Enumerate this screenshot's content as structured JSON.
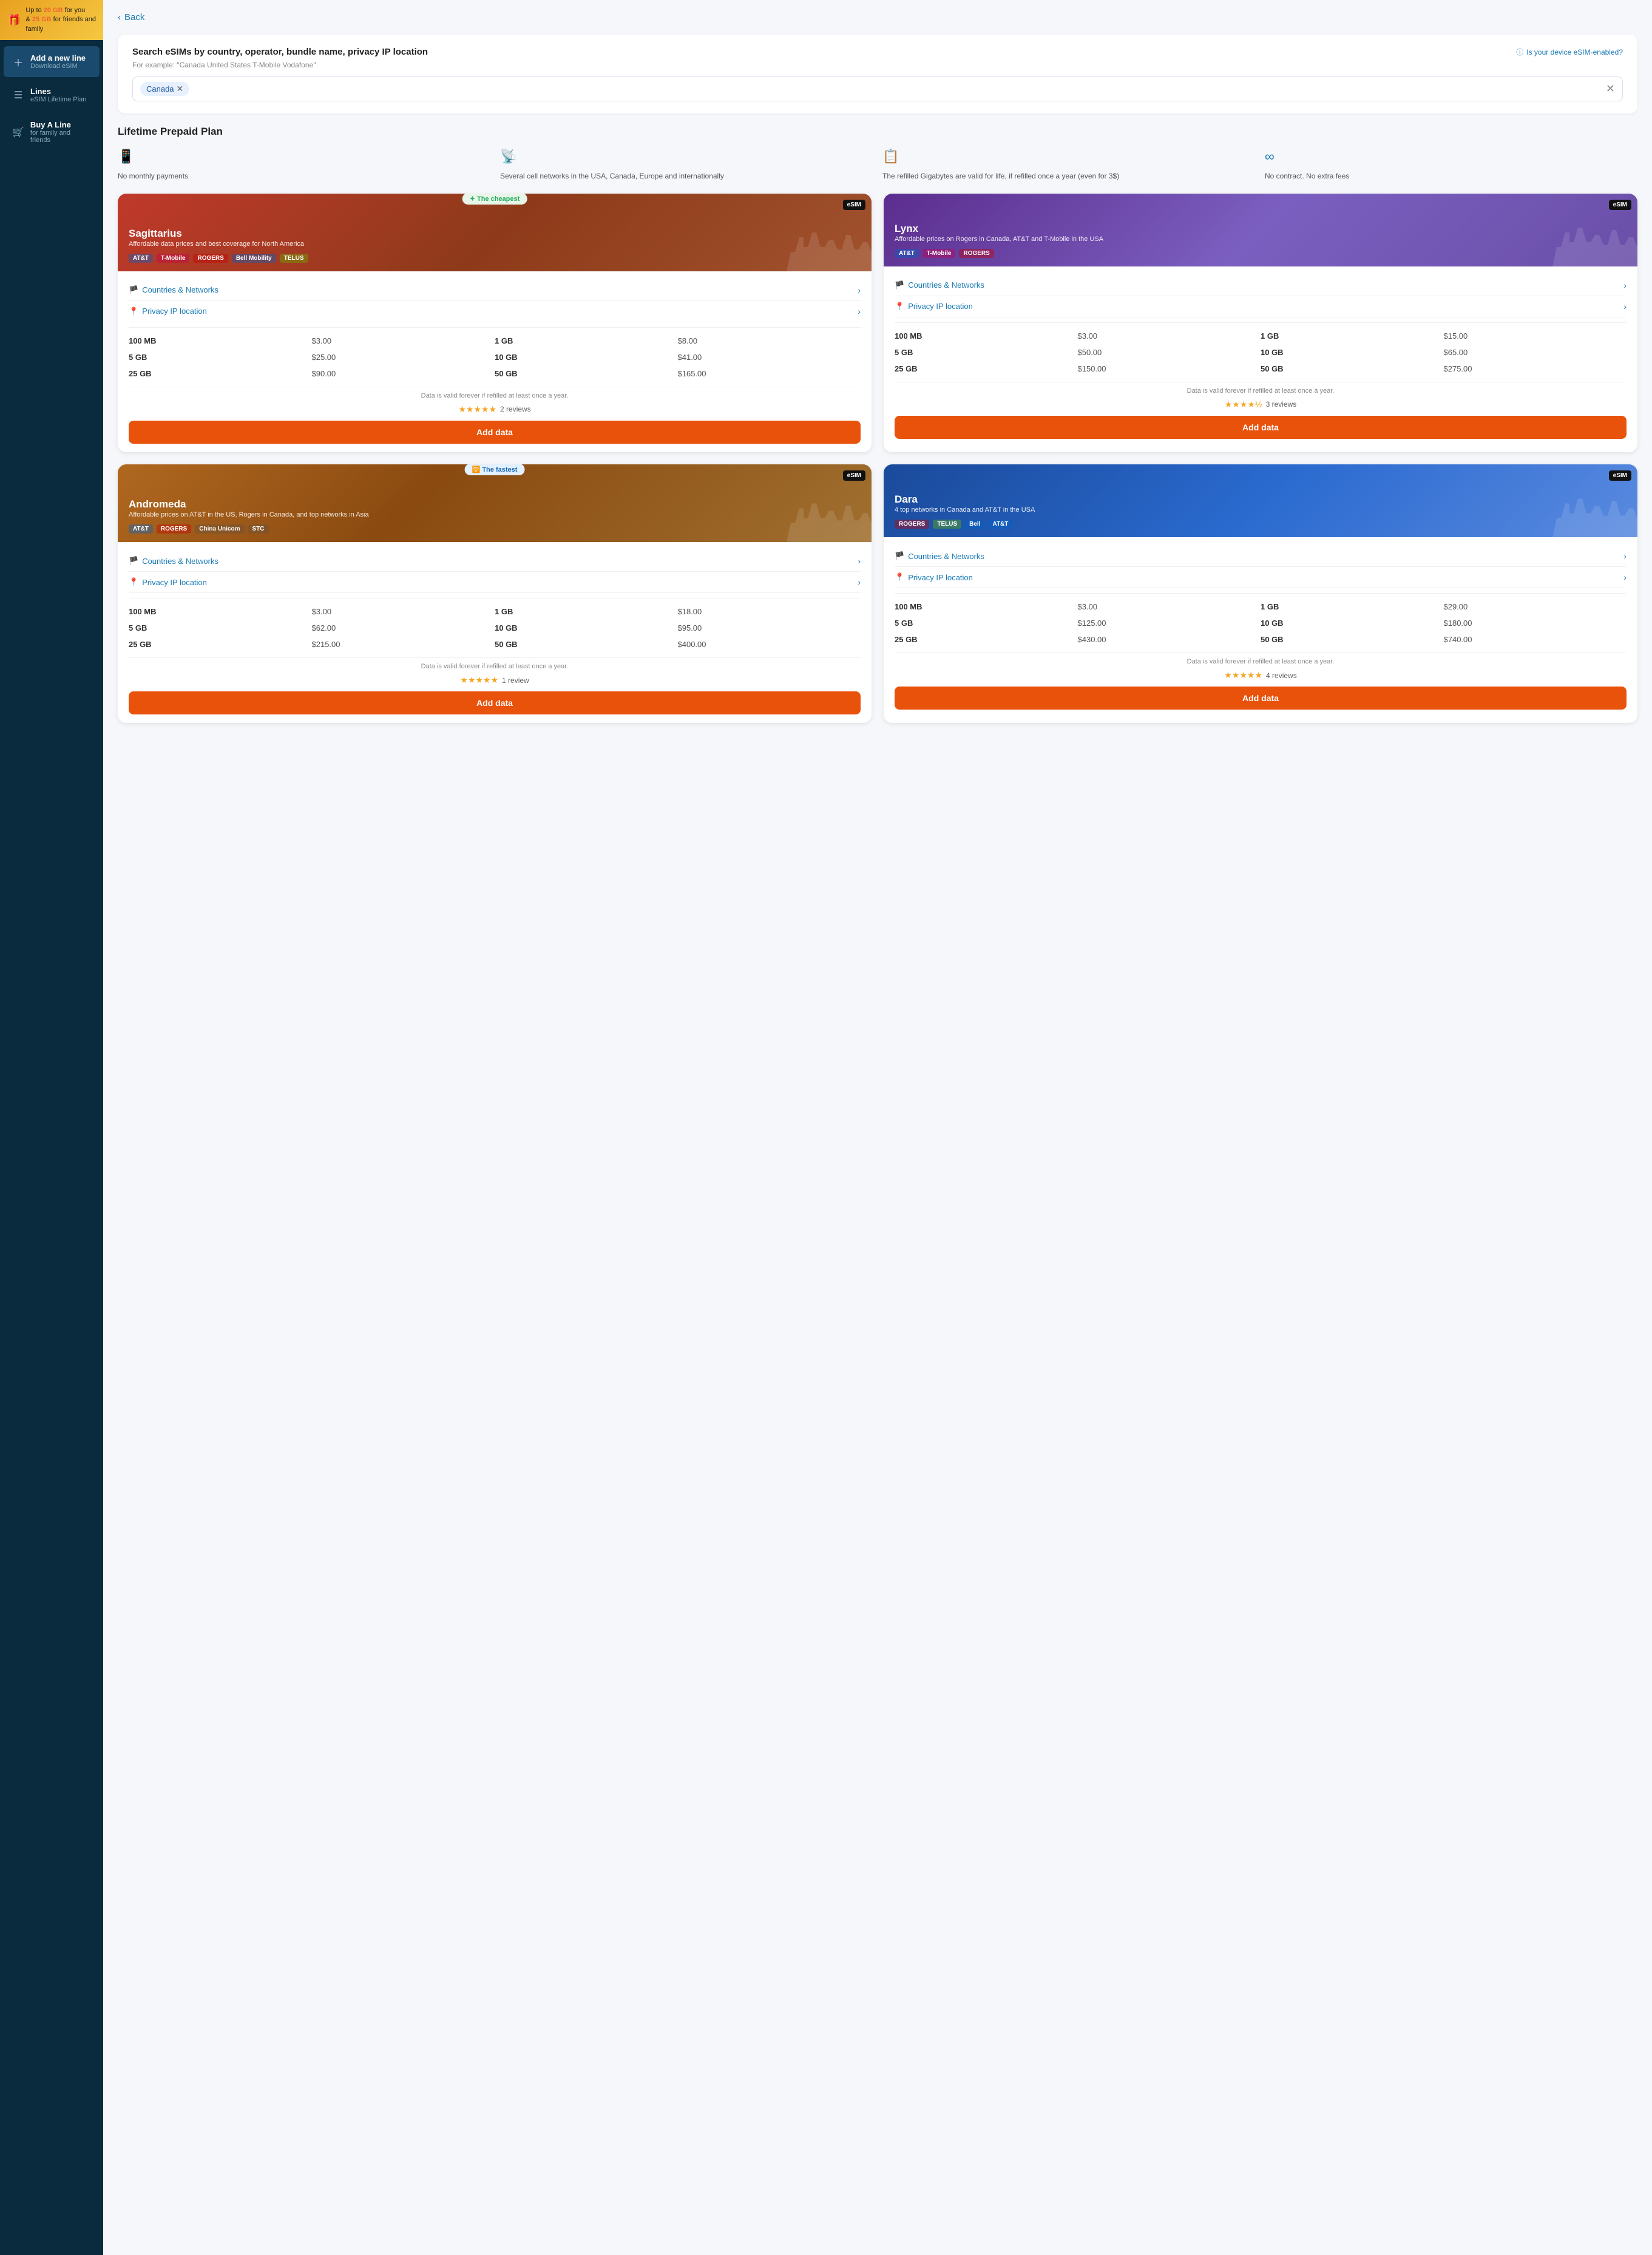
{
  "promo": {
    "line1": "Up to 20 GB for you",
    "line2": "& 25 GB for friends and family"
  },
  "nav": [
    {
      "id": "add-line",
      "icon": "➕",
      "title": "Add a new line",
      "sub": "Download eSIM",
      "active": true
    },
    {
      "id": "lines",
      "icon": "📋",
      "title": "Lines",
      "sub": "eSIM Lifetime Plan",
      "active": false
    },
    {
      "id": "buy-line",
      "icon": "🛒",
      "title": "Buy A Line",
      "sub": "for family and friends",
      "active": false
    }
  ],
  "back_label": "Back",
  "search": {
    "title": "Search eSIMs by country, operator, bundle name, privacy IP location",
    "hint": "For example: \"Canada United States T-Mobile Vodafone\"",
    "tag": "Canada",
    "esim_check": "Is your device eSIM-enabled?",
    "placeholder": ""
  },
  "plan_title": "Lifetime Prepaid Plan",
  "features": [
    {
      "id": "no-monthly",
      "icon": "📱",
      "text": "No monthly payments"
    },
    {
      "id": "networks",
      "icon": "📡",
      "text": "Several cell networks in the USA, Canada, Europe and internationally"
    },
    {
      "id": "refill",
      "icon": "📋",
      "text": "The refilled Gigabytes are valid for life, if refilled once a year (even for 3$)"
    },
    {
      "id": "no-contract",
      "icon": "∞",
      "text": "No contract. No extra fees"
    }
  ],
  "cards": [
    {
      "id": "sagittarius",
      "name": "Sagittarius",
      "subtitle": "Affordable data prices and best coverage for North America",
      "hero_class": "card-hero-sagittarius",
      "badge": "eSIM",
      "pill_label": "✦ The cheapest",
      "pill_class": "",
      "networks": [
        "AT&T",
        "T-Mobile",
        "ROGERS",
        "Bell Mobility",
        "TELUS"
      ],
      "countries_label": "Countries & Networks",
      "privacy_label": "Privacy IP location",
      "pricing": [
        {
          "size": "100 MB",
          "price": "$3.00",
          "size2": "1 GB",
          "price2": "$8.00"
        },
        {
          "size": "5 GB",
          "price": "$25.00",
          "size2": "10 GB",
          "price2": "$41.00"
        },
        {
          "size": "25 GB",
          "price": "$90.00",
          "size2": "50 GB",
          "price2": "$165.00"
        }
      ],
      "validity": "Data is valid forever if refilled at least once a year.",
      "stars": "★★★★★",
      "reviews": "2 reviews",
      "btn_label": "Add data"
    },
    {
      "id": "lynx",
      "name": "Lynx",
      "subtitle": "Affordable prices on Rogers in Canada, AT&T and T-Mobile in the USA",
      "hero_class": "card-hero-lynx",
      "badge": "eSIM",
      "pill_label": null,
      "pill_class": null,
      "networks": [
        "AT&T",
        "T-Mobile",
        "ROGERS"
      ],
      "countries_label": "Countries & Networks",
      "privacy_label": "Privacy IP location",
      "pricing": [
        {
          "size": "100 MB",
          "price": "$3.00",
          "size2": "1 GB",
          "price2": "$15.00"
        },
        {
          "size": "5 GB",
          "price": "$50.00",
          "size2": "10 GB",
          "price2": "$65.00"
        },
        {
          "size": "25 GB",
          "price": "$150.00",
          "size2": "50 GB",
          "price2": "$275.00"
        }
      ],
      "validity": "Data is valid forever if refilled at least once a year.",
      "stars": "★★★★½",
      "reviews": "3 reviews",
      "btn_label": "Add data"
    },
    {
      "id": "andromeda",
      "name": "Andromeda",
      "subtitle": "Affordable prices on AT&T in the US, Rogers in Canada, and top networks in Asia",
      "hero_class": "card-hero-andromeda",
      "badge": "eSIM",
      "pill_label": "🛜 The fastest",
      "pill_class": "fastest",
      "networks": [
        "AT&T",
        "ROGERS",
        "China Unicom",
        "STC"
      ],
      "countries_label": "Countries & Networks",
      "privacy_label": "Privacy IP location",
      "pricing": [
        {
          "size": "100 MB",
          "price": "$3.00",
          "size2": "1 GB",
          "price2": "$18.00"
        },
        {
          "size": "5 GB",
          "price": "$62.00",
          "size2": "10 GB",
          "price2": "$95.00"
        },
        {
          "size": "25 GB",
          "price": "$215.00",
          "size2": "50 GB",
          "price2": "$400.00"
        }
      ],
      "validity": "Data is valid forever if refilled at least once a year.",
      "stars": "★★★★★",
      "reviews": "1 review",
      "btn_label": "Add data"
    },
    {
      "id": "dara",
      "name": "Dara",
      "subtitle": "4 top networks in Canada and AT&T in the USA",
      "hero_class": "card-hero-dara",
      "badge": "eSIM",
      "pill_label": null,
      "pill_class": null,
      "networks": [
        "ROGERS",
        "TELUS",
        "Bell",
        "AT&T"
      ],
      "countries_label": "Countries & Networks",
      "privacy_label": "Privacy IP location",
      "pricing": [
        {
          "size": "100 MB",
          "price": "$3.00",
          "size2": "1 GB",
          "price2": "$29.00"
        },
        {
          "size": "5 GB",
          "price": "$125.00",
          "size2": "10 GB",
          "price2": "$180.00"
        },
        {
          "size": "25 GB",
          "price": "$430.00",
          "size2": "50 GB",
          "price2": "$740.00"
        }
      ],
      "validity": "Data is valid forever if refilled at least once a year.",
      "stars": "★★★★★",
      "reviews": "4 reviews",
      "btn_label": "Add data"
    }
  ]
}
